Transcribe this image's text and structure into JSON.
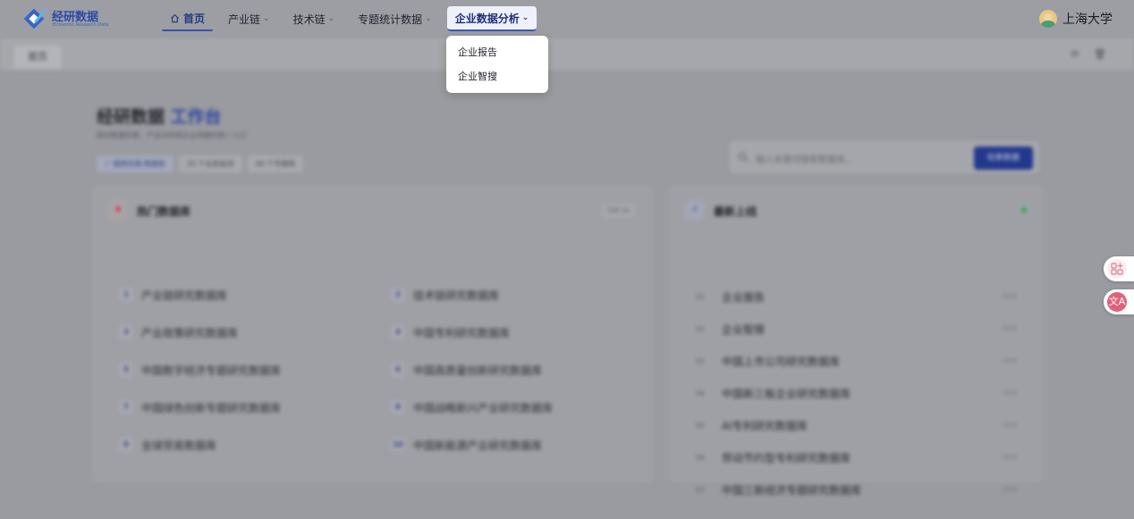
{
  "brand": {
    "title": "经研数据",
    "subtitle": "Economic Research Data",
    "accent": "#2c4aa8"
  },
  "nav": {
    "items": [
      {
        "label": "首页",
        "has_dropdown": false,
        "state": "current"
      },
      {
        "label": "产业链",
        "has_dropdown": true
      },
      {
        "label": "技术链",
        "has_dropdown": true
      },
      {
        "label": "专题统计数据",
        "has_dropdown": true
      },
      {
        "label": "企业数据分析",
        "has_dropdown": true,
        "state": "open"
      }
    ],
    "open_menu": {
      "items": [
        "企业报告",
        "企业智搜"
      ]
    }
  },
  "user": {
    "name": "上海大学"
  },
  "tabs": {
    "items": [
      "首页"
    ],
    "tools": [
      "refresh-icon",
      "trash-icon"
    ]
  },
  "workspace": {
    "title_main": "经研数据",
    "title_highlight": "工作台",
    "subtitle": "面向数据检索、产业分析和企业洞察的统一入口",
    "chips": [
      "✓ 按照实践 数据库",
      "20 个业务板块",
      "46 个专题库"
    ],
    "search": {
      "placeholder": "输入关键词搜索数据库...",
      "button": "检索数据"
    }
  },
  "hot": {
    "title": "热门数据库",
    "badge": "TOP 10",
    "items": [
      {
        "num": "1",
        "name": "产业链研究数据库"
      },
      {
        "num": "2",
        "name": "技术链研究数据库"
      },
      {
        "num": "3",
        "name": "产业政策研究数据库"
      },
      {
        "num": "4",
        "name": "中国专利研究数据库"
      },
      {
        "num": "5",
        "name": "中国数字经济专题研究数据库"
      },
      {
        "num": "6",
        "name": "中国高质量创新研究数据库"
      },
      {
        "num": "7",
        "name": "中国绿色创新专题研究数据库"
      },
      {
        "num": "8",
        "name": "中国战略新兴产业研究数据库"
      },
      {
        "num": "9",
        "name": "全球贸易数据库"
      },
      {
        "num": "10",
        "name": "中国新能源产业研究数据库"
      }
    ]
  },
  "latest": {
    "title": "最新上线",
    "status_color": "#2aa84a",
    "items": [
      {
        "idx": "01",
        "name": "企业报告",
        "tag": "NEW"
      },
      {
        "idx": "02",
        "name": "企业智搜",
        "tag": "NEW"
      },
      {
        "idx": "03",
        "name": "中国上市公司研究数据库",
        "tag": "NEW"
      },
      {
        "idx": "04",
        "name": "中国新三板企业研究数据库",
        "tag": "NEW"
      },
      {
        "idx": "05",
        "name": "AI专利研究数据库",
        "tag": "NEW"
      },
      {
        "idx": "06",
        "name": "劳动节约型专利研究数据库",
        "tag": "NEW"
      },
      {
        "idx": "07",
        "name": "中国三新经济专题研究数据库",
        "tag": "NEW"
      }
    ]
  },
  "floating": {
    "apps": "apps-plus-icon",
    "translate": "translate-icon",
    "translate_glyph": "文A"
  }
}
